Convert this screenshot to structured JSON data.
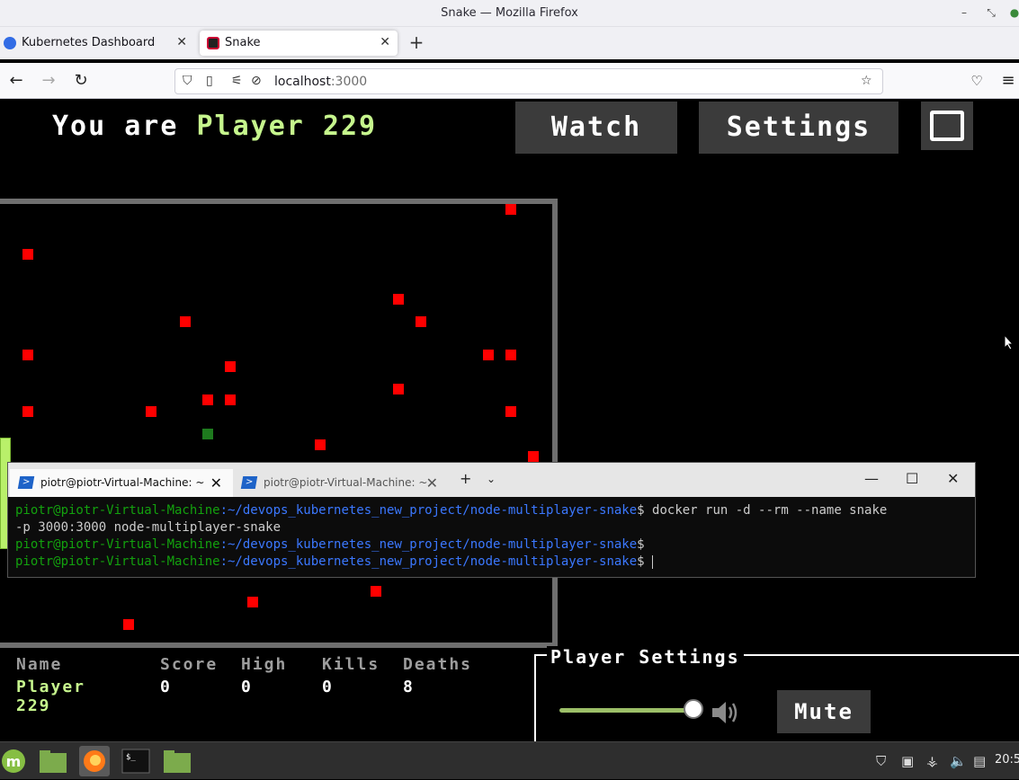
{
  "window": {
    "title": "Snake — Mozilla Firefox"
  },
  "tabs": [
    {
      "label": "Kubernetes Dashboard",
      "active": false
    },
    {
      "label": "Snake",
      "active": true
    }
  ],
  "url": {
    "host": "localhost",
    "port": ":3000"
  },
  "game": {
    "you_are": "You are",
    "player_name": "Player 229",
    "watch_label": "Watch",
    "settings_label": "Settings",
    "board_border_color": "#6f6f6f",
    "snake_color": "#b9f06a",
    "food_color": "#ff0000",
    "score": {
      "headers": [
        "Name",
        "Score",
        "High",
        "Kills",
        "Deaths"
      ],
      "row": [
        "Player 229",
        "0",
        "0",
        "0",
        "8"
      ]
    },
    "player_settings": {
      "title": "Player Settings",
      "volume": 1.0,
      "mute_label": "Mute"
    }
  },
  "terminal": {
    "tabs": [
      {
        "label": "piotr@piotr-Virtual-Machine: ~",
        "active": true
      },
      {
        "label": "piotr@piotr-Virtual-Machine: ~",
        "active": false
      }
    ],
    "lines": [
      {
        "user": "piotr@piotr-Virtual-Machine",
        "path": ":~/devops_kubernetes_new_project/node-multiplayer-snake",
        "cmd": "$ docker run -d --rm --name snake"
      },
      {
        "plain": "-p 3000:3000 node-multiplayer-snake"
      },
      {
        "user": "piotr@piotr-Virtual-Machine",
        "path": ":~/devops_kubernetes_new_project/node-multiplayer-snake",
        "cmd": "$"
      },
      {
        "user": "piotr@piotr-Virtual-Machine",
        "path": ":~/devops_kubernetes_new_project/node-multiplayer-snake",
        "cmd": "$ "
      }
    ]
  },
  "taskbar": {
    "clock": "20:5"
  }
}
